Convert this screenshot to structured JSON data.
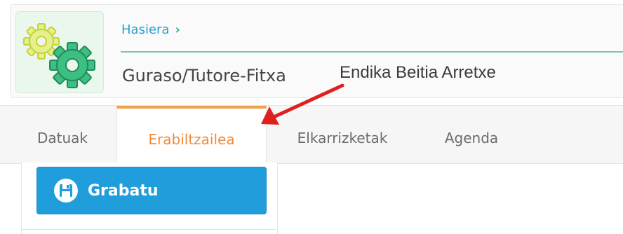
{
  "breadcrumb": {
    "home_label": "Hasiera",
    "separator": "›"
  },
  "page": {
    "title": "Guraso/Tutore-Fitxa"
  },
  "annotation": {
    "name_label": "Endika Beitia Arretxe"
  },
  "tabs": [
    {
      "label": "Datuak",
      "active": false
    },
    {
      "label": "Erabiltzailea",
      "active": true
    },
    {
      "label": "Elkarrizketak",
      "active": false
    },
    {
      "label": "Agenda",
      "active": false
    }
  ],
  "toolbar": {
    "save_label": "Grabatu"
  },
  "icons": {
    "logo": "gears-icon",
    "save": "floppy-disk-icon",
    "breadcrumb_separator": "chevron-right-icon",
    "annotation": "red-arrow-icon"
  },
  "colors": {
    "accent_blue": "#1f9edb",
    "active_tab": "#f08a3c",
    "active_tab_border": "#f0a34c",
    "breadcrumb": "#2a9fd0",
    "gear_yellow": "#d9e84a",
    "gear_green": "#2fae73",
    "arrow_red": "#e02020"
  }
}
